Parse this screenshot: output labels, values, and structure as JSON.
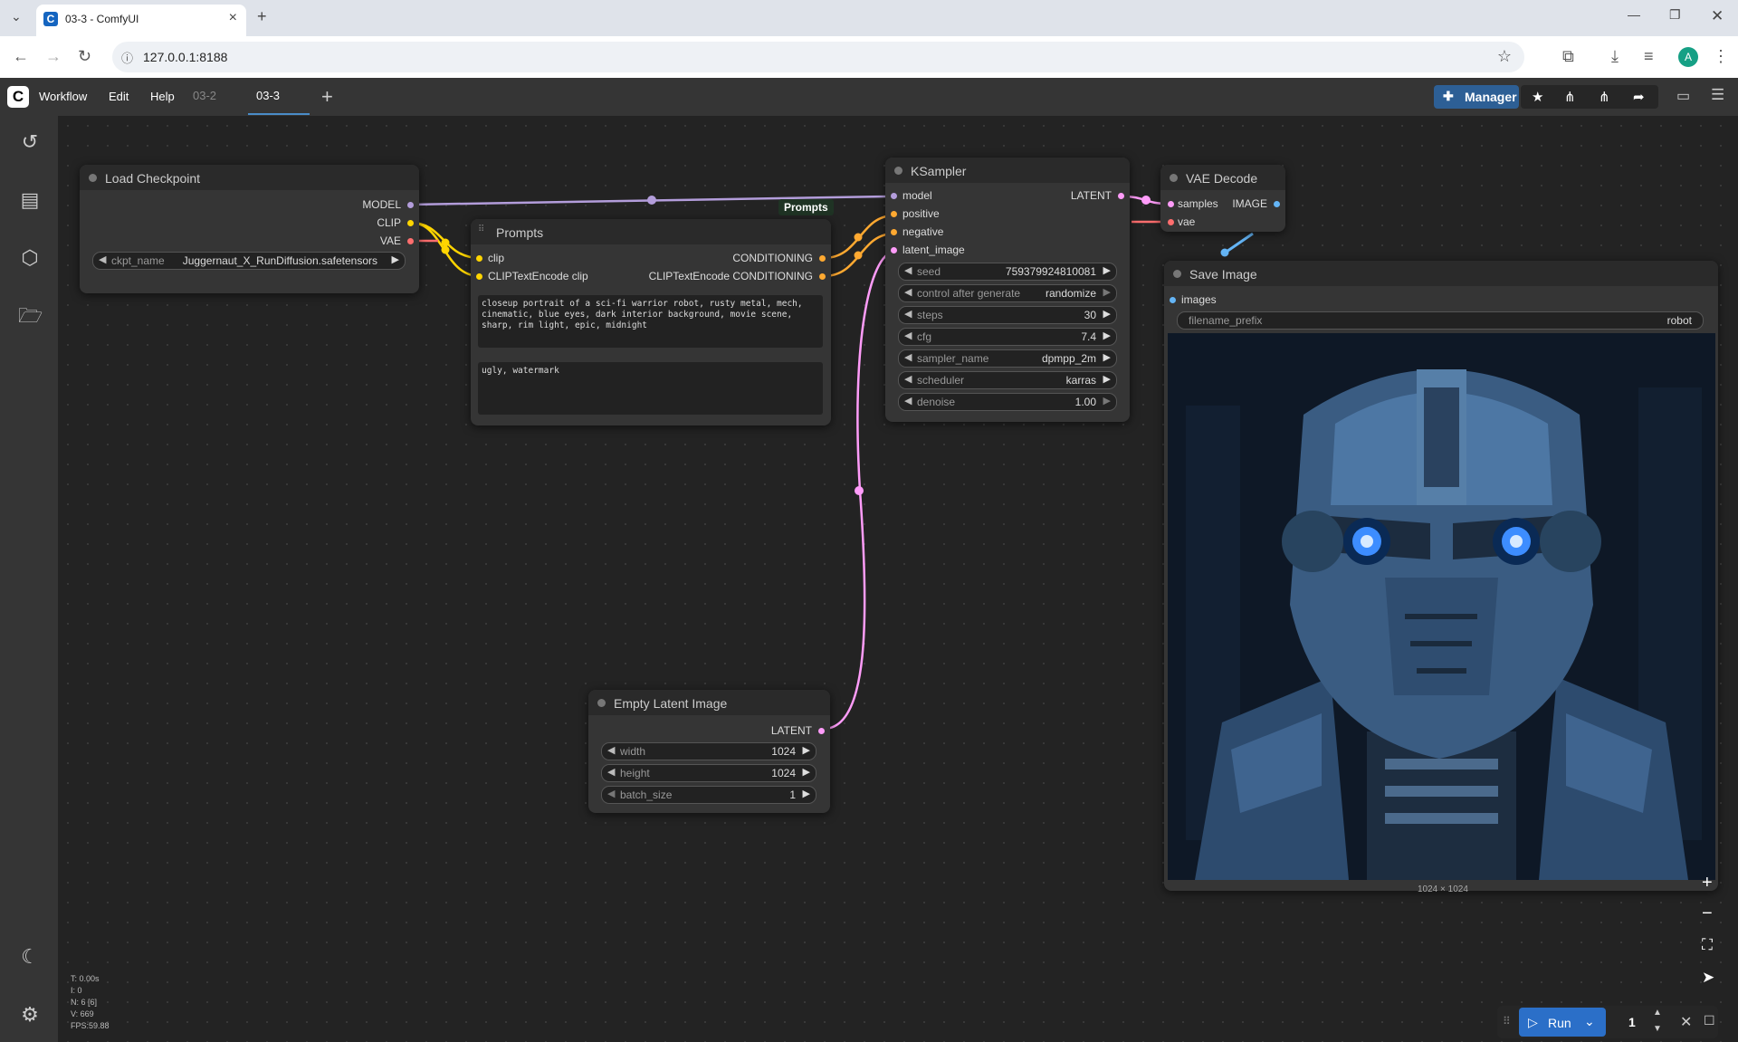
{
  "browser": {
    "tab_title": "03-3 - ComfyUI",
    "url": "127.0.0.1:8188",
    "profile_initial": "A"
  },
  "menubar": {
    "items": [
      "Workflow",
      "Edit",
      "Help"
    ],
    "workflow_tabs": [
      "03-2",
      "03-3"
    ],
    "active_tab": "03-3",
    "manager_label": "Manager"
  },
  "nodes": {
    "load_checkpoint": {
      "title": "Load Checkpoint",
      "outputs": [
        "MODEL",
        "CLIP",
        "VAE"
      ],
      "ckpt_label": "ckpt_name",
      "ckpt_value": "Juggernaut_X_RunDiffusion.safetensors"
    },
    "prompts": {
      "title": "Prompts",
      "group_label": "Prompts",
      "inputs": [
        "clip",
        "CLIPTextEncode clip"
      ],
      "outputs": [
        "CONDITIONING",
        "CLIPTextEncode CONDITIONING"
      ],
      "positive_text": "closeup portrait of a sci-fi warrior robot, rusty metal, mech, cinematic, blue eyes, dark interior background, movie scene, sharp, rim light, epic, midnight",
      "negative_text": "ugly, watermark"
    },
    "ksampler": {
      "title": "KSampler",
      "inputs": [
        "model",
        "positive",
        "negative",
        "latent_image"
      ],
      "output": "LATENT",
      "widgets": [
        {
          "label": "seed",
          "value": "759379924810081"
        },
        {
          "label": "control after generate",
          "value": "randomize"
        },
        {
          "label": "steps",
          "value": "30"
        },
        {
          "label": "cfg",
          "value": "7.4"
        },
        {
          "label": "sampler_name",
          "value": "dpmpp_2m"
        },
        {
          "label": "scheduler",
          "value": "karras"
        },
        {
          "label": "denoise",
          "value": "1.00"
        }
      ]
    },
    "vae_decode": {
      "title": "VAE Decode",
      "inputs": [
        "samples",
        "vae"
      ],
      "output": "IMAGE"
    },
    "save_image": {
      "title": "Save Image",
      "input": "images",
      "prefix_label": "filename_prefix",
      "prefix_value": "robot",
      "dims": "1024 × 1024"
    },
    "empty_latent": {
      "title": "Empty Latent Image",
      "output": "LATENT",
      "widgets": [
        {
          "label": "width",
          "value": "1024"
        },
        {
          "label": "height",
          "value": "1024"
        },
        {
          "label": "batch_size",
          "value": "1"
        }
      ]
    }
  },
  "stats": [
    "T: 0.00s",
    "I: 0",
    "N: 6 [6]",
    "V: 669",
    "FPS:59.88"
  ],
  "run": {
    "label": "Run",
    "count": "1"
  },
  "colors": {
    "model": "#b39ddb",
    "clip": "#ffd500",
    "vae": "#ff6e6e",
    "conditioning": "#ffa931",
    "latent": "#ff9cf9",
    "image": "#64b5f6",
    "accent": "#2b6fc8"
  },
  "icons": [
    "history-icon",
    "queue-icon",
    "model-library-icon",
    "workflows-icon",
    "theme-moon-icon",
    "settings-gear-icon"
  ]
}
